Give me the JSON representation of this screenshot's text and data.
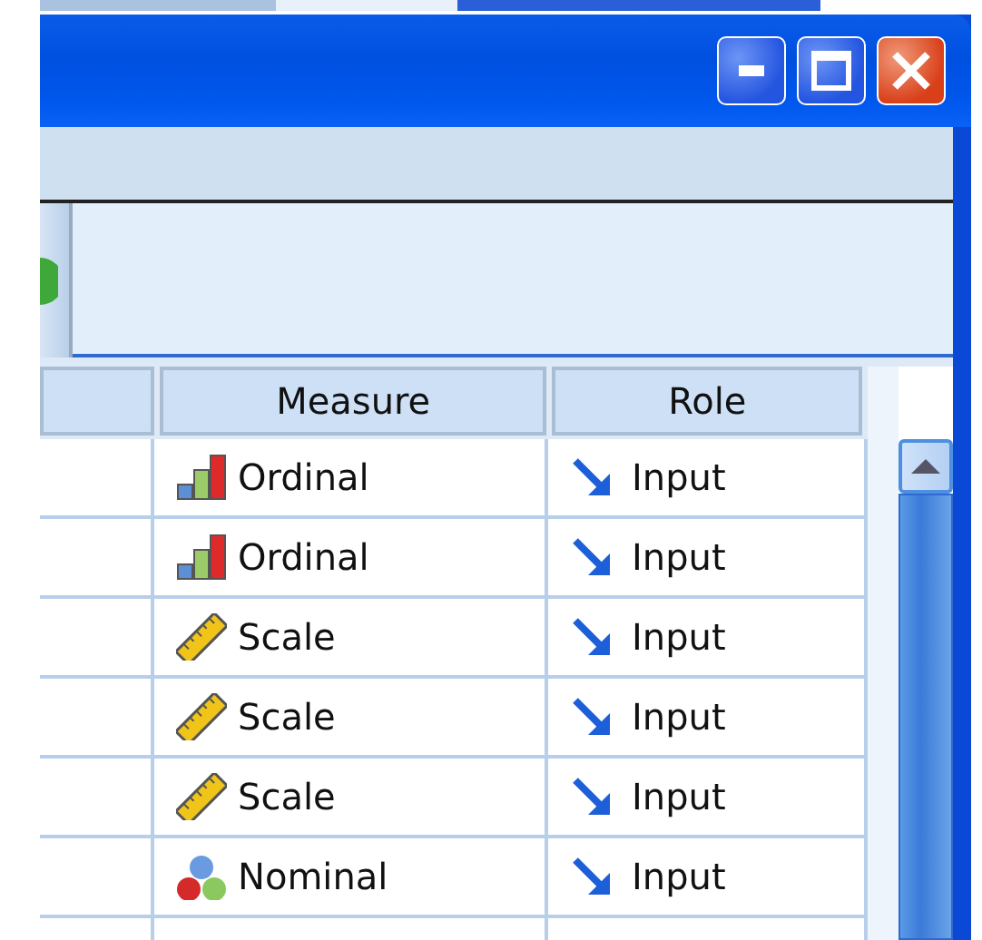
{
  "table": {
    "columns": [
      "Measure",
      "Role"
    ],
    "rows": [
      {
        "measure": {
          "kind": "ordinal",
          "label": "Ordinal"
        },
        "role": {
          "kind": "input",
          "label": "Input"
        }
      },
      {
        "measure": {
          "kind": "ordinal",
          "label": "Ordinal"
        },
        "role": {
          "kind": "input",
          "label": "Input"
        }
      },
      {
        "measure": {
          "kind": "scale",
          "label": "Scale"
        },
        "role": {
          "kind": "input",
          "label": "Input"
        }
      },
      {
        "measure": {
          "kind": "scale",
          "label": "Scale"
        },
        "role": {
          "kind": "input",
          "label": "Input"
        }
      },
      {
        "measure": {
          "kind": "scale",
          "label": "Scale"
        },
        "role": {
          "kind": "input",
          "label": "Input"
        }
      },
      {
        "measure": {
          "kind": "nominal",
          "label": "Nominal"
        },
        "role": {
          "kind": "input",
          "label": "Input"
        }
      }
    ]
  }
}
